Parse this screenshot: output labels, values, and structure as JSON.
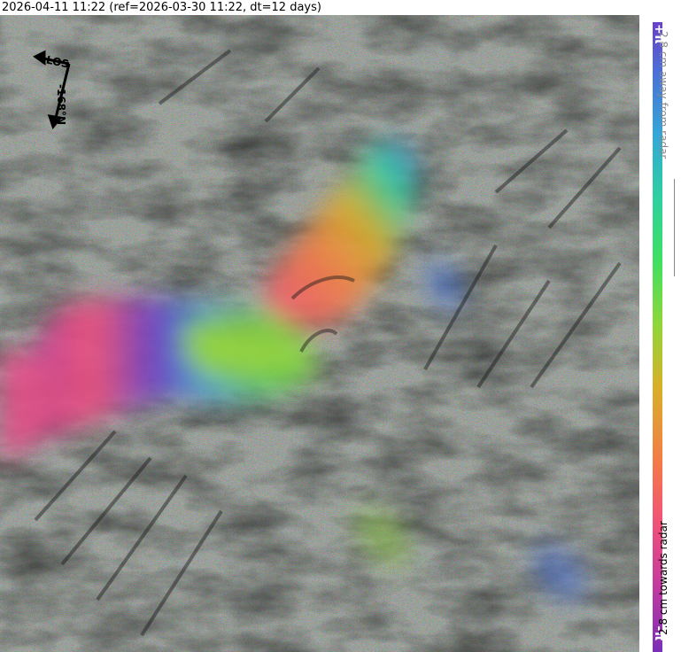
{
  "header": {
    "title": "2026-04-11 11:22 (ref=2026-03-30 11:22, dt=12 days)"
  },
  "compass": {
    "los_label": "LOS",
    "heading_label": "-168°N"
  },
  "colorbar": {
    "top_label": "+π",
    "bottom_label": "-π",
    "away_text": "2.8 cm away from radar",
    "towards_text": "2.8 cm towards radar",
    "colors": [
      "#7a2fb8",
      "#c03aa0",
      "#f0507a",
      "#f47a48",
      "#d8b028",
      "#8fd63a",
      "#3fe060",
      "#2ed0a0",
      "#32a8d8",
      "#4a70d8",
      "#6a40c8"
    ]
  }
}
